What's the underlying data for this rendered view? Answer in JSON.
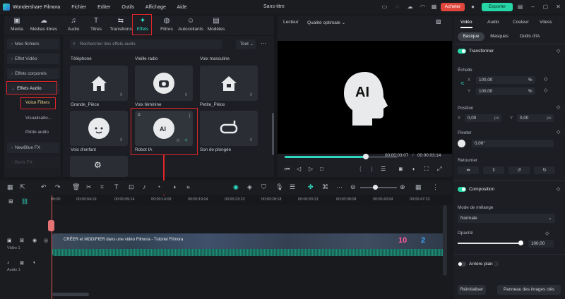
{
  "app": {
    "name": "Wondershare Filmora",
    "doc_title": "Sans-titre",
    "buy_label": "Acheter",
    "export_label": "Exporter"
  },
  "menu": [
    "Fichier",
    "Editer",
    "Outils",
    "Affichage",
    "Aide"
  ],
  "media_tabs": [
    {
      "label": "Média",
      "icon": "folder-icon"
    },
    {
      "label": "Médias libres",
      "icon": "cloud-icon"
    },
    {
      "label": "Audio",
      "icon": "music-icon"
    },
    {
      "label": "Titres",
      "icon": "text-icon"
    },
    {
      "label": "Transitions",
      "icon": "transition-icon"
    },
    {
      "label": "Effets",
      "icon": "effects-icon"
    },
    {
      "label": "Filtres",
      "icon": "filter-icon"
    },
    {
      "label": "Autocollants",
      "icon": "sticker-icon"
    },
    {
      "label": "Modèles",
      "icon": "template-icon"
    }
  ],
  "sidebar": {
    "items": [
      "Mes fichiers",
      "Effet Vidéo",
      "Effets corporels",
      "Effets Audio",
      "NewBlue FX",
      "Boris FX"
    ],
    "subitems": [
      "Voice Filters",
      "Visualisatio...",
      "Pilote audio"
    ]
  },
  "effects": {
    "search_placeholder": "Rechercher des effets audio",
    "filter_value": "Tout",
    "top_labels": [
      "Téléphone",
      "Vieille radio",
      "Voix masculine"
    ],
    "cards": [
      {
        "label": "Grande_Pièce",
        "icon": "house-icon"
      },
      {
        "label": "Voix féminine",
        "icon": "robot-face-icon"
      },
      {
        "label": "Petite_Pièce",
        "icon": "house-icon"
      },
      {
        "label": "Voix d'enfant",
        "icon": "child-face-icon"
      },
      {
        "label": "Robot IA",
        "icon": "ai-head-icon"
      },
      {
        "label": "Son de plongée",
        "icon": "diving-mask-icon"
      }
    ]
  },
  "player": {
    "label": "Lecteur",
    "quality": "Qualité optimale",
    "time_current": "00:00:03:07",
    "time_total": "00:00:03:14",
    "progress": 0.72,
    "badge": "AI"
  },
  "props": {
    "tabs": [
      "Vidéo",
      "Audio",
      "Couleur",
      "Vitess"
    ],
    "subtabs": [
      "Basique",
      "Masques",
      "Outils d'IA"
    ],
    "transform_title": "Transformer",
    "scale_label": "Échelle",
    "scale_x": "100,00",
    "scale_y": "100,00",
    "position_label": "Position",
    "pos_x": "0,00",
    "pos_y": "0,00",
    "pos_unit": "px",
    "percent_unit": "%",
    "rotate_label": "Pivoter",
    "rotate_value": "0,00°",
    "flip_label": "Retourner",
    "composition_title": "Composition",
    "blend_label": "Mode de mélange",
    "blend_value": "Normale",
    "opacity_label": "Opacité",
    "opacity_value": "100,00",
    "background_title": "Arrière plan",
    "reset_label": "Réinitialiser",
    "keyframes_label": "Panneau des images clés"
  },
  "timeline": {
    "ticks": [
      "00:00",
      "00:00:04:19",
      "00:00:09:14",
      "00:00:14:09",
      "00:00:19:04",
      "00:00:23:23",
      "00:00:28:18",
      "00:00:33:13",
      "00:00:38:08",
      "00:00:43:04",
      "00:00:47:23"
    ],
    "video_track": "Vidéo 1",
    "audio_track": "Audio 1",
    "clip_text": "CRÉER et MODIFIER dans une vidéo Filmora - Tutoriel Filmora"
  }
}
